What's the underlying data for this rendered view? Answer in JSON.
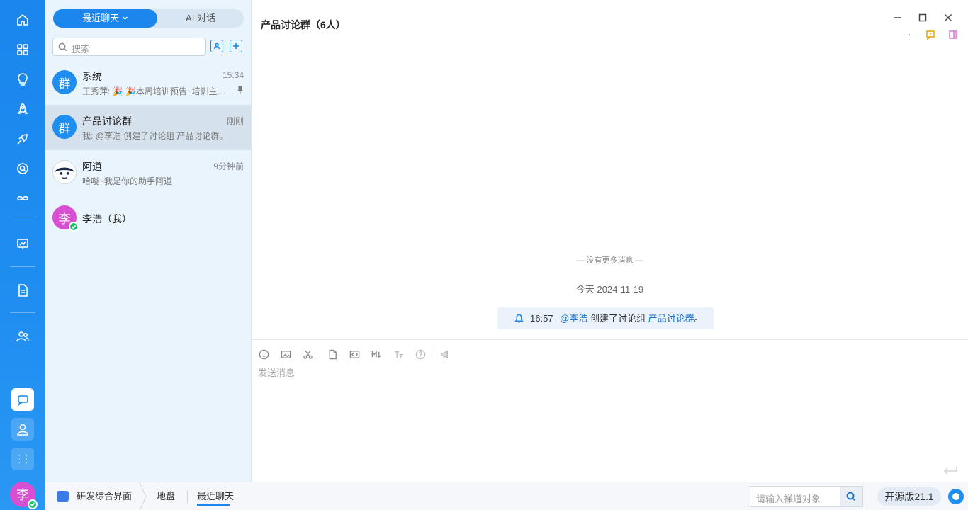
{
  "window": {
    "title": "产品讨论群（6人）"
  },
  "sidebar": {
    "icons": [
      "home-icon",
      "apps-icon",
      "lightbulb-icon",
      "rocket-icon",
      "sprint-icon",
      "search-circle-icon",
      "infinity-icon",
      "chart-board-icon",
      "document-icon",
      "team-icon",
      "chat-icon",
      "user-icon",
      "grid-icon"
    ],
    "avatar_char": "李"
  },
  "list": {
    "tabs": {
      "recent": "最近聊天",
      "ai": "AI 对话"
    },
    "search_placeholder": "搜索",
    "items": [
      {
        "avatar": "群",
        "name": "系统",
        "time": "15:34",
        "preview": "王秀萍: 🎉 🎉本周培训预告: 培训主…",
        "pinned": true
      },
      {
        "avatar": "群",
        "name": "产品讨论群",
        "time": "刚刚",
        "preview": "我: @李浩 创建了讨论组 产品讨论群。"
      },
      {
        "avatar": "",
        "name": "阿道",
        "time": "9分钟前",
        "preview": "哈喽~我是你的助手阿道"
      },
      {
        "avatar": "李",
        "name": "李浩（我）",
        "time": "",
        "preview": ""
      }
    ]
  },
  "main": {
    "no_more": "— 没有更多消息 —",
    "date": "今天 2024-11-19",
    "notice": {
      "time": "16:57",
      "mention": "@李浩",
      "text": " 创建了讨论组 ",
      "group": "产品讨论群",
      "end": "。"
    },
    "composer_placeholder": "发送消息"
  },
  "footer": {
    "crumb1": "研发综合界面",
    "crumb2": "地盘",
    "crumb3": "最近聊天",
    "search_placeholder": "请输入禅道对象",
    "version": "开源版21.1"
  },
  "colors": {
    "accent": "#1a86ee",
    "sidebar": "#1f8ef0",
    "list_bg": "#eaf4fd",
    "selected": "#d5e1ec",
    "me_avatar": "#d94fd2"
  }
}
